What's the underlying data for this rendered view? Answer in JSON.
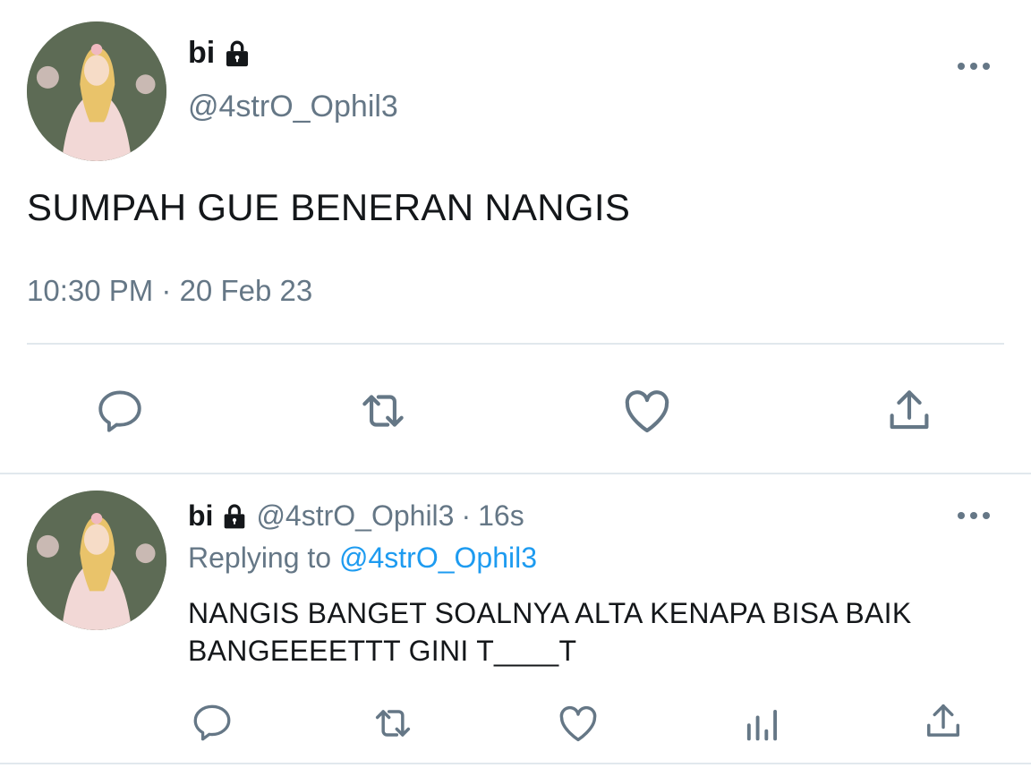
{
  "tweet": {
    "display_name": "bi",
    "handle": "@4strO_Ophil3",
    "text": "SUMPAH GUE BENERAN NANGIS",
    "timestamp": "10:30 PM · 20 Feb 23",
    "icons": [
      "reply-icon",
      "retweet-icon",
      "like-icon",
      "share-icon"
    ]
  },
  "reply": {
    "display_name": "bi",
    "handle": "@4strO_Ophil3",
    "separator": "·",
    "age": "16s",
    "replying_prefix": "Replying to",
    "replying_to": "@4strO_Ophil3",
    "text": "NANGIS BANGET SOALNYA ALTA KENAPA BISA BAIK BANGEEEETTT GINI T____T",
    "icons": [
      "reply-icon",
      "retweet-icon",
      "like-icon",
      "analytics-icon",
      "share-icon"
    ]
  },
  "colors": {
    "text": "#14171a",
    "secondary": "#657786",
    "link": "#1d9bf0",
    "divider": "#e1e8ed"
  }
}
